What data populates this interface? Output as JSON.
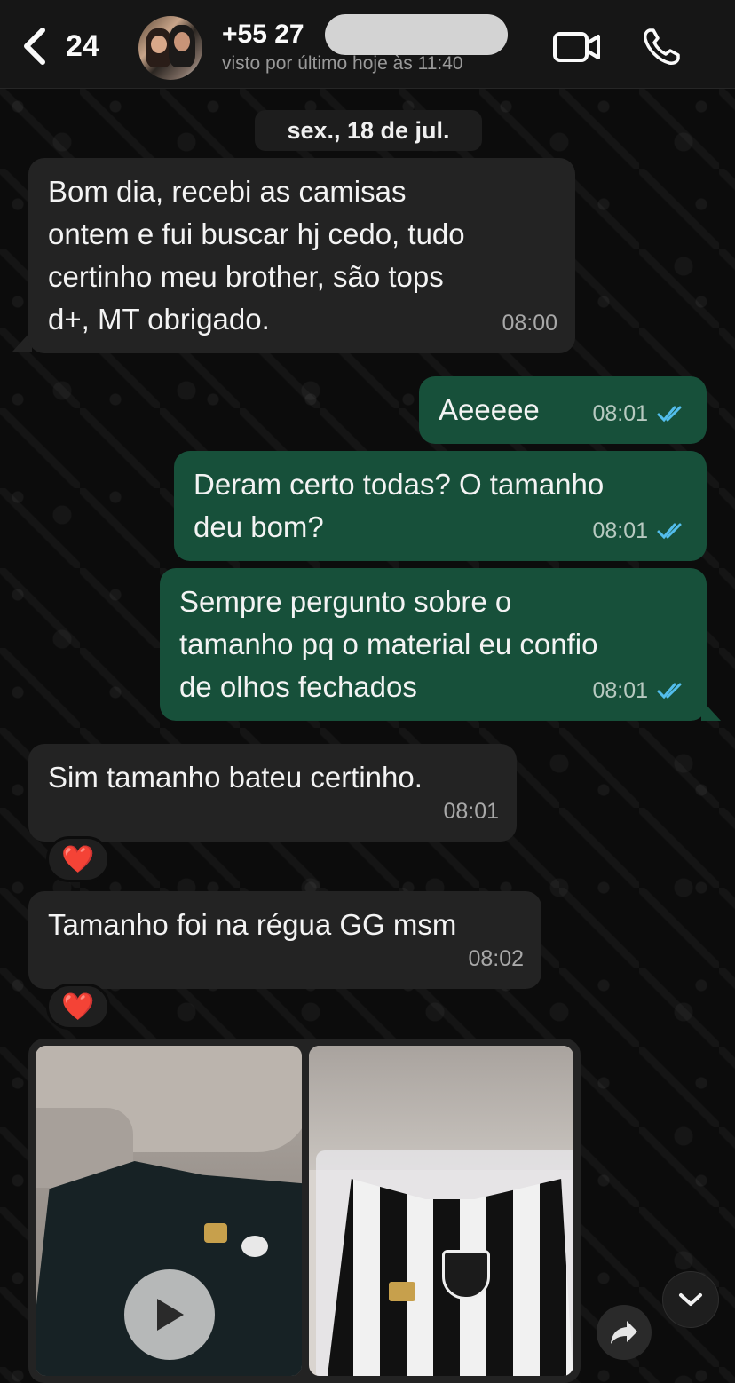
{
  "header": {
    "back_count": "24",
    "contact_name": "+55 27",
    "last_seen": "visto por último hoje às 11:40",
    "icons": [
      "back-chevron-icon",
      "video-call-icon",
      "phone-call-icon"
    ]
  },
  "chat": {
    "date_separator": "sex., 18 de jul.",
    "messages": [
      {
        "direction": "incoming",
        "text": "Bom dia, recebi as camisas\nontem e fui buscar hj cedo, tudo\ncertinho meu brother, são tops\nd+, MT obrigado.",
        "time": "08:00"
      },
      {
        "direction": "outgoing",
        "text": "Aeeeee",
        "time": "08:01",
        "status": "read"
      },
      {
        "direction": "outgoing",
        "text": "Deram certo todas? O tamanho\ndeu bom?",
        "time": "08:01",
        "status": "read"
      },
      {
        "direction": "outgoing",
        "text": "Sempre pergunto sobre o\ntamanho pq o material eu confio\nde olhos fechados",
        "time": "08:01",
        "status": "read"
      },
      {
        "direction": "incoming",
        "text": "Sim tamanho bateu certinho.",
        "time": "08:01",
        "reaction": "❤️"
      },
      {
        "direction": "incoming",
        "text": "Tamanho foi na régua GG msm",
        "time": "08:02",
        "reaction": "❤️"
      }
    ],
    "media": {
      "items": [
        "video",
        "photo"
      ],
      "play_icon": "play-icon",
      "forward_icon": "forward-icon",
      "scroll_icon": "chevron-down-icon"
    }
  },
  "colors": {
    "incoming_bubble": "#232323",
    "outgoing_bubble": "#17503a",
    "read_ticks": "#53bdeb",
    "reaction_heart": "#e0242e"
  }
}
